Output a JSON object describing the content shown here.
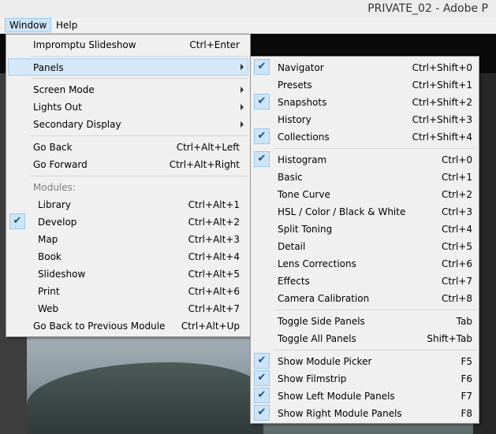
{
  "window_title": "PRIVATE_02 - Adobe P",
  "menubar": {
    "window": "Window",
    "help": "Help"
  },
  "window_menu": {
    "impromptu_slideshow": {
      "label": "Impromptu Slideshow",
      "shortcut": "Ctrl+Enter"
    },
    "panels": {
      "label": "Panels"
    },
    "screen_mode": {
      "label": "Screen Mode"
    },
    "lights_out": {
      "label": "Lights Out"
    },
    "secondary_display": {
      "label": "Secondary Display"
    },
    "go_back": {
      "label": "Go Back",
      "shortcut": "Ctrl+Alt+Left"
    },
    "go_forward": {
      "label": "Go Forward",
      "shortcut": "Ctrl+Alt+Right"
    },
    "modules_header": "Modules:",
    "modules": [
      {
        "label": "Library",
        "shortcut": "Ctrl+Alt+1",
        "checked": false
      },
      {
        "label": "Develop",
        "shortcut": "Ctrl+Alt+2",
        "checked": true
      },
      {
        "label": "Map",
        "shortcut": "Ctrl+Alt+3",
        "checked": false
      },
      {
        "label": "Book",
        "shortcut": "Ctrl+Alt+4",
        "checked": false
      },
      {
        "label": "Slideshow",
        "shortcut": "Ctrl+Alt+5",
        "checked": false
      },
      {
        "label": "Print",
        "shortcut": "Ctrl+Alt+6",
        "checked": false
      },
      {
        "label": "Web",
        "shortcut": "Ctrl+Alt+7",
        "checked": false
      }
    ],
    "go_back_previous": {
      "label": "Go Back to Previous Module",
      "shortcut": "Ctrl+Alt+Up"
    }
  },
  "panels_menu": {
    "group1": [
      {
        "label": "Navigator",
        "shortcut": "Ctrl+Shift+0",
        "checked": true
      },
      {
        "label": "Presets",
        "shortcut": "Ctrl+Shift+1",
        "checked": false
      },
      {
        "label": "Snapshots",
        "shortcut": "Ctrl+Shift+2",
        "checked": true
      },
      {
        "label": "History",
        "shortcut": "Ctrl+Shift+3",
        "checked": false
      },
      {
        "label": "Collections",
        "shortcut": "Ctrl+Shift+4",
        "checked": true
      }
    ],
    "group2": [
      {
        "label": "Histogram",
        "shortcut": "Ctrl+0",
        "checked": true
      },
      {
        "label": "Basic",
        "shortcut": "Ctrl+1",
        "checked": false
      },
      {
        "label": "Tone Curve",
        "shortcut": "Ctrl+2",
        "checked": false
      },
      {
        "label": "HSL / Color / Black & White",
        "shortcut": "Ctrl+3",
        "checked": false
      },
      {
        "label": "Split Toning",
        "shortcut": "Ctrl+4",
        "checked": false
      },
      {
        "label": "Detail",
        "shortcut": "Ctrl+5",
        "checked": false
      },
      {
        "label": "Lens Corrections",
        "shortcut": "Ctrl+6",
        "checked": false
      },
      {
        "label": "Effects",
        "shortcut": "Ctrl+7",
        "checked": false
      },
      {
        "label": "Camera Calibration",
        "shortcut": "Ctrl+8",
        "checked": false
      }
    ],
    "group3": [
      {
        "label": "Toggle Side Panels",
        "shortcut": "Tab",
        "checked": false
      },
      {
        "label": "Toggle All Panels",
        "shortcut": "Shift+Tab",
        "checked": false
      }
    ],
    "group4": [
      {
        "label": "Show Module Picker",
        "shortcut": "F5",
        "checked": true
      },
      {
        "label": "Show Filmstrip",
        "shortcut": "F6",
        "checked": true
      },
      {
        "label": "Show Left Module Panels",
        "shortcut": "F7",
        "checked": true
      },
      {
        "label": "Show Right Module Panels",
        "shortcut": "F8",
        "checked": true
      }
    ]
  },
  "icons": {
    "check": "checkmark-icon",
    "submenu": "submenu-arrow-icon"
  }
}
